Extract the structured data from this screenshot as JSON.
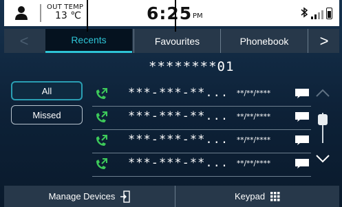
{
  "status_bar": {
    "temp_label": "OUT TEMP",
    "temp_value": "13 ℃",
    "time": "6:25",
    "ampm": "PM",
    "icons": [
      "user-icon",
      "bluetooth-icon",
      "signal-icon",
      "battery-icon"
    ]
  },
  "tabs": {
    "prev_arrow": "<",
    "recents": "Recents",
    "favourites": "Favourites",
    "phonebook": "Phonebook",
    "next_arrow": ">"
  },
  "contact": {
    "name": "********01"
  },
  "filters": {
    "all": "All",
    "missed": "Missed"
  },
  "calls": [
    {
      "number": "***-***-**...",
      "date": "**/**/****",
      "type": "outgoing-call-icon"
    },
    {
      "number": "***-***-**...",
      "date": "**/**/****",
      "type": "outgoing-call-icon"
    },
    {
      "number": "***-***-**...",
      "date": "**/**/****",
      "type": "outgoing-call-icon"
    },
    {
      "number": "***-***-**...",
      "date": "**/**/****",
      "type": "outgoing-call-icon"
    }
  ],
  "bottom_bar": {
    "manage_devices": "Manage Devices",
    "keypad": "Keypad"
  },
  "colors": {
    "accent": "#2ec4d6",
    "call_icon": "#3dc95a",
    "background": "#0d2137"
  }
}
